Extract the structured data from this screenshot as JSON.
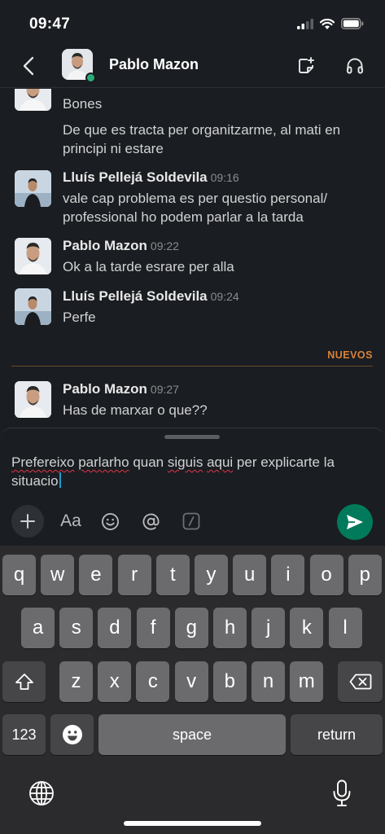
{
  "status_bar": {
    "time": "09:47"
  },
  "header": {
    "contact_name": "Pablo Mazon"
  },
  "messages": {
    "first_group": {
      "line1": "Bones",
      "line2": "De que es tracta per organitzarme, al mati en principi ni estare"
    },
    "m1": {
      "author": "Lluís Pellejá Soldevila",
      "time": "09:16",
      "text": "vale cap problema es per questio personal/ professional ho podem parlar a la tarda"
    },
    "m2": {
      "author": "Pablo Mazon",
      "time": "09:22",
      "text": "Ok a la tarde esrare per alla"
    },
    "m3": {
      "author": "Lluís Pellejá Soldevila",
      "time": "09:24",
      "text": "Perfe"
    },
    "new_label": "NUEVOS",
    "m4": {
      "author": "Pablo Mazon",
      "time": "09:27",
      "text": "Has de marxar o que??"
    }
  },
  "composer": {
    "text_parts": [
      "Prefereixo",
      " ",
      "parlarho",
      " quan ",
      "siguis",
      " ",
      "aqui",
      " per explicarte la situacio"
    ],
    "toolbar": {
      "format_label": "Aa"
    }
  },
  "keyboard": {
    "row1": [
      "q",
      "w",
      "e",
      "r",
      "t",
      "y",
      "u",
      "i",
      "o",
      "p"
    ],
    "row2": [
      "a",
      "s",
      "d",
      "f",
      "g",
      "h",
      "j",
      "k",
      "l"
    ],
    "row3": [
      "z",
      "x",
      "c",
      "v",
      "b",
      "n",
      "m"
    ],
    "numbers_label": "123",
    "space_label": "space",
    "return_label": "return"
  },
  "colors": {
    "background": "#1a1d21",
    "presence_online": "#2bac76",
    "send_button": "#007a5a",
    "new_label": "#d8823a",
    "caret": "#1d9bd1"
  },
  "icons": [
    "chevron-left-icon",
    "canvas-note-icon",
    "headphones-icon",
    "plus-icon",
    "emoji-icon",
    "at-icon",
    "slash-command-icon",
    "send-icon",
    "shift-icon",
    "backspace-icon",
    "globe-icon",
    "microphone-icon",
    "signal-icon",
    "wifi-icon",
    "battery-icon"
  ]
}
